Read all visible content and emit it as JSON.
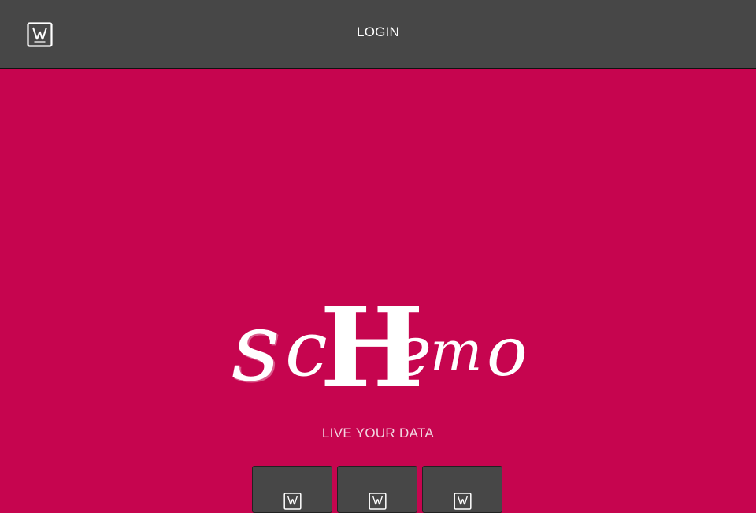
{
  "header": {
    "logo_icon": "logo-icon",
    "login_label": "LOGIN"
  },
  "hero": {
    "wordmark": "scHemo",
    "tagline": "LIVE YOUR DATA"
  },
  "tiles": [
    {
      "icon": "logo-icon"
    },
    {
      "icon": "logo-icon"
    },
    {
      "icon": "logo-icon"
    }
  ],
  "colors": {
    "brand": "#c6054f",
    "header_bg": "#474747",
    "text": "#ffffff"
  }
}
